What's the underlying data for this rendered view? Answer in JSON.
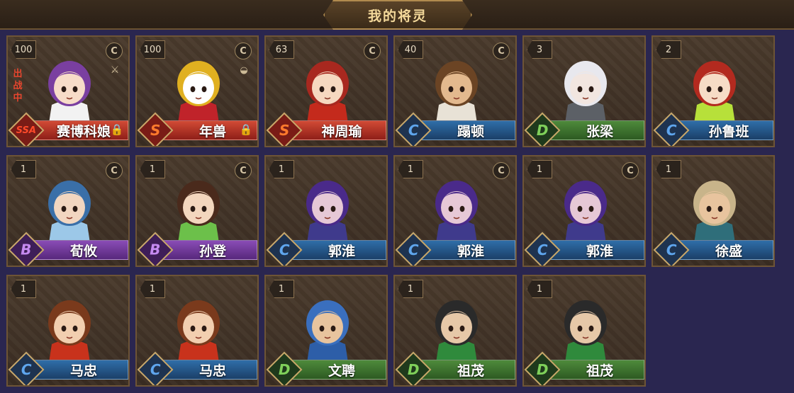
{
  "header": {
    "title": "我的将灵"
  },
  "battle_label": "出战中",
  "rank_colors": {
    "S": "#d24a35",
    "C": "#2f6ea8",
    "D": "#4e8a3b",
    "B": "#8a4cb6"
  },
  "cards": [
    {
      "level": "100",
      "rank": "SSA",
      "name": "赛博科娘",
      "c_icon": true,
      "sword": true,
      "lock": true,
      "battle": true,
      "hair": "#7a3fa0",
      "skin": "#f7dcc8",
      "outfit": "#f2f2f2"
    },
    {
      "level": "100",
      "rank": "S",
      "name": "年兽",
      "c_icon": true,
      "cup": true,
      "lock": true,
      "hair": "#e0b020",
      "skin": "#ffffff",
      "outfit": "#c0232a"
    },
    {
      "level": "63",
      "rank": "S",
      "name": "神周瑜",
      "c_icon": true,
      "hair": "#a8281f",
      "skin": "#f6d8c0",
      "outfit": "#c42a1c"
    },
    {
      "level": "40",
      "rank": "C",
      "name": "蹋顿",
      "c_icon": true,
      "hair": "#6b4424",
      "skin": "#e3b98e",
      "outfit": "#e8e2d6"
    },
    {
      "level": "3",
      "rank": "D",
      "name": "张梁",
      "hair": "#e8e8ee",
      "skin": "#f2e6e0",
      "outfit": "#5c6066"
    },
    {
      "level": "2",
      "rank": "C",
      "name": "孙鲁班",
      "hair": "#b32a1f",
      "skin": "#f6dcc6",
      "outfit": "#b7e03a"
    },
    {
      "level": "1",
      "rank": "B",
      "name": "荀攸",
      "c_icon": true,
      "hair": "#3a6fa8",
      "skin": "#f2d6c0",
      "outfit": "#9cc8e8"
    },
    {
      "level": "1",
      "rank": "B",
      "name": "孙登",
      "c_icon": true,
      "hair": "#4a2a1c",
      "skin": "#f3d6be",
      "outfit": "#6cc04a"
    },
    {
      "level": "1",
      "rank": "C",
      "name": "郭淮",
      "hair": "#4a2a8a",
      "skin": "#e6c8d6",
      "outfit": "#3f3a8c"
    },
    {
      "level": "1",
      "rank": "C",
      "name": "郭淮",
      "c_icon": true,
      "hair": "#4a2a8a",
      "skin": "#e6c8d6",
      "outfit": "#3f3a8c"
    },
    {
      "level": "1",
      "rank": "C",
      "name": "郭淮",
      "c_icon": true,
      "hair": "#4a2a8a",
      "skin": "#e6c8d6",
      "outfit": "#3f3a8c"
    },
    {
      "level": "1",
      "rank": "C",
      "name": "徐盛",
      "hair": "#c8b48a",
      "skin": "#e8c49e",
      "outfit": "#2f6e7a"
    },
    {
      "level": "1",
      "rank": "C",
      "name": "马忠",
      "hair": "#7a3a1c",
      "skin": "#f2cfb0",
      "outfit": "#c8321c"
    },
    {
      "level": "1",
      "rank": "C",
      "name": "马忠",
      "hair": "#7a3a1c",
      "skin": "#f2cfb0",
      "outfit": "#c8321c"
    },
    {
      "level": "1",
      "rank": "D",
      "name": "文聘",
      "hair": "#3a6fbe",
      "skin": "#e8c49e",
      "outfit": "#2d5ea8"
    },
    {
      "level": "1",
      "rank": "D",
      "name": "祖茂",
      "hair": "#2a2a2a",
      "skin": "#e6c8a8",
      "outfit": "#2f8a3c"
    },
    {
      "level": "1",
      "rank": "D",
      "name": "祖茂",
      "hair": "#2a2a2a",
      "skin": "#e6c8a8",
      "outfit": "#2f8a3c"
    }
  ]
}
